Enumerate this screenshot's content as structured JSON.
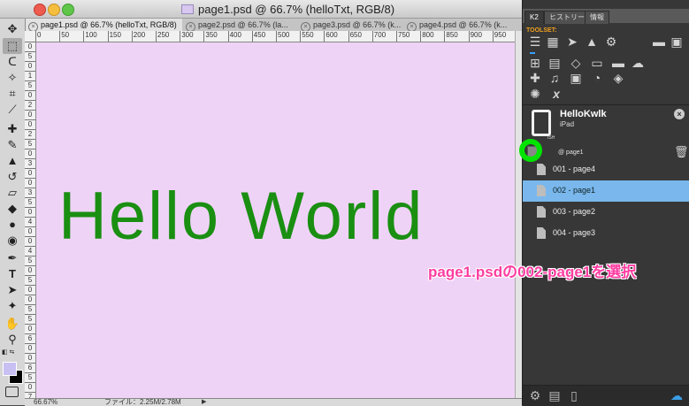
{
  "window": {
    "title": "page1.psd @ 66.7% (helloTxt, RGB/8)"
  },
  "tabs": [
    {
      "label": "page1.psd @ 66.7% (helloTxt, RGB/8)",
      "active": true
    },
    {
      "label": "page2.psd @ 66.7% (la..."
    },
    {
      "label": "page3.psd @ 66.7% (k..."
    },
    {
      "label": "page4.psd @ 66.7% (k..."
    }
  ],
  "ruler": {
    "h_ticks": [
      "0",
      "50",
      "100",
      "150",
      "200",
      "250",
      "300",
      "350",
      "400",
      "450",
      "500",
      "550",
      "600",
      "650",
      "700",
      "750",
      "800",
      "850",
      "900",
      "950"
    ],
    "v_ticks": [
      "0",
      "5",
      "0",
      "1",
      "5",
      "0",
      "2",
      "0",
      "0",
      "2",
      "5",
      "0",
      "3",
      "0",
      "0",
      "3",
      "5",
      "0",
      "4",
      "0",
      "0",
      "4",
      "5",
      "0",
      "5",
      "0",
      "0",
      "5",
      "5",
      "0",
      "6",
      "0",
      "0",
      "6",
      "5",
      "0",
      "7"
    ]
  },
  "canvas": {
    "text": "Hello World",
    "background": "#efd3f7",
    "text_color": "#1a8f12"
  },
  "status": {
    "zoom": "66.67%",
    "file_info": "ファイル：2.25M/2.78M"
  },
  "toolbar": {
    "tools": [
      "move-icon",
      "marquee-icon",
      "lasso-icon",
      "magic-wand-icon",
      "crop-icon",
      "eyedropper-icon",
      "healing-icon",
      "brush-icon",
      "stamp-icon",
      "history-brush-icon",
      "eraser-icon",
      "bucket-icon",
      "blur-icon",
      "dodge-icon",
      "pen-icon",
      "type-icon",
      "path-select-icon",
      "shape-icon",
      "hand-icon",
      "zoom-icon"
    ],
    "fg_color": "#c8bff2",
    "bg_color": "#000000"
  },
  "panel": {
    "tabs": [
      "K2",
      "ヒストリー",
      "情報"
    ],
    "toolset_label": "TOOLSET:",
    "icon_row1": [
      "list-icon",
      "grid-icon",
      "cursor-icon",
      "rocket-icon",
      "gear-icon",
      "folder-icon",
      "folder-gear-icon"
    ],
    "icon_row2": [
      "add-page-icon",
      "pages-icon",
      "code-icon",
      "terminal-icon",
      "card-icon",
      "chat-icon"
    ],
    "icon_row3": [
      "plus-icon",
      "music-icon",
      "gallery-icon",
      "timer-icon",
      "layers-icon"
    ],
    "icon_row4": [
      "spinner-icon",
      "formula-icon"
    ],
    "device": {
      "name": "HelloKwlk",
      "type": "iPad",
      "tiny_label": "ISH"
    },
    "page_ref": "@ page1",
    "pages": [
      {
        "label": "001 - page4",
        "selected": false
      },
      {
        "label": "002 - page1",
        "selected": true
      },
      {
        "label": "003 - page2",
        "selected": false
      },
      {
        "label": "004 - page3",
        "selected": false
      }
    ],
    "bottom_icons": [
      "settings-icon",
      "print-icon",
      "document-icon",
      "cloud-icon"
    ]
  },
  "annotation": {
    "callout": "page1.psdの002-page1を選択",
    "callout_color": "#ff3da1",
    "highlight_color": "#00e400"
  }
}
